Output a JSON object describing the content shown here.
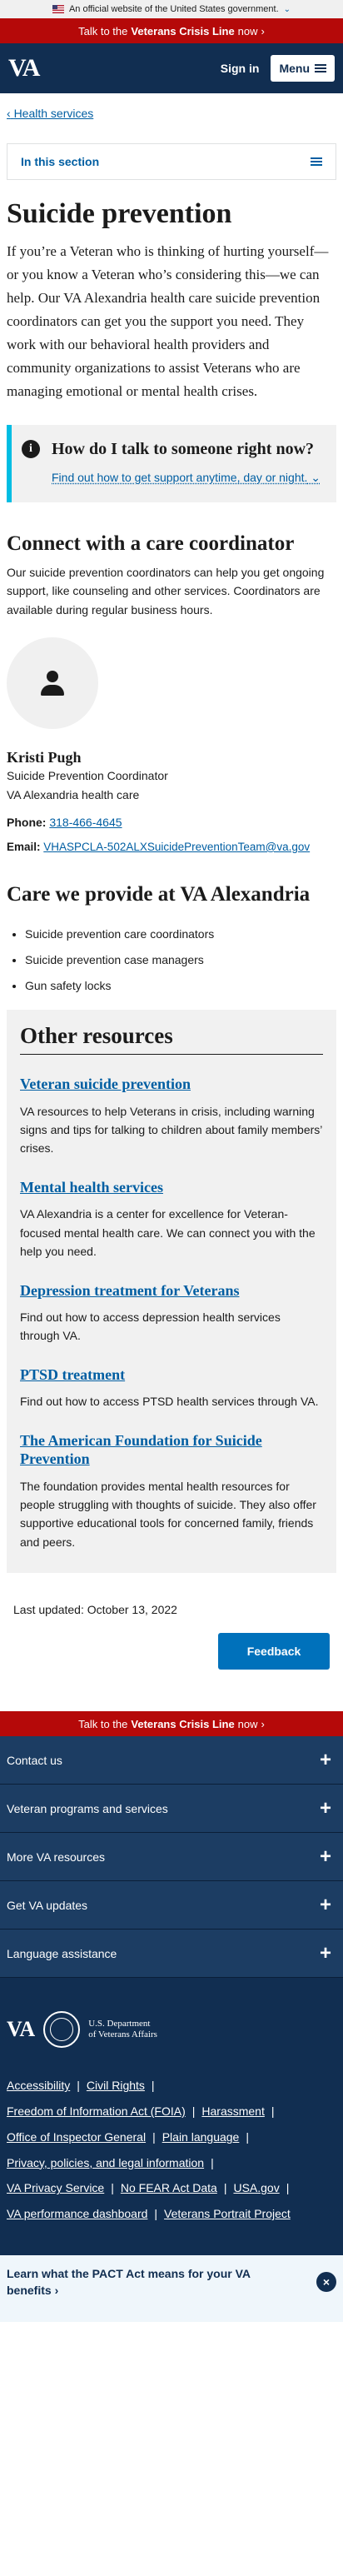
{
  "official_banner": {
    "text": "An official website of the United States government.",
    "chevron": "⌄"
  },
  "crisis_bar": {
    "prefix": "Talk to the",
    "bold": "Veterans Crisis Line",
    "suffix": "now",
    "chevron": "›"
  },
  "header": {
    "logo": "VA",
    "sign_in": "Sign in",
    "menu": "Menu"
  },
  "breadcrumb": {
    "arrow": "‹",
    "label": "Health services"
  },
  "in_section": {
    "label": "In this section"
  },
  "page": {
    "title": "Suicide prevention",
    "intro": "If you’re a Veteran who is thinking of hurting yourself—or you know a Veteran who’s considering this—we can help. Our VA Alexandria health care suicide prevention coordinators can get you the support you need. They work with our behavioral health providers and community organizations to assist Veterans who are managing emotional or mental health crises."
  },
  "alert": {
    "icon": "i",
    "heading": "How do I talk to someone right now?",
    "link": "Find out how to get support anytime, day or night.",
    "chevron": "⌄"
  },
  "coordinator": {
    "heading": "Connect with a care coordinator",
    "body": "Our suicide prevention coordinators can help you get ongoing support, like counseling and other services. Coordinators are available during regular business hours.",
    "name": "Kristi Pugh",
    "role": "Suicide Prevention Coordinator",
    "facility": "VA Alexandria health care",
    "phone_label": "Phone:",
    "phone": "318-466-4645",
    "email_label": "Email:",
    "email": "VHASPCLA-502ALXSuicidePreventionTeam@va.gov"
  },
  "care": {
    "heading": "Care we provide at VA Alexandria",
    "items": [
      "Suicide prevention care coordinators",
      "Suicide prevention case managers",
      "Gun safety locks"
    ]
  },
  "other_resources": {
    "heading": "Other resources",
    "items": [
      {
        "title": "Veteran suicide prevention",
        "desc": "VA resources to help Veterans in crisis, including warning signs and tips for talking to children about family members’ crises."
      },
      {
        "title": "Mental health services",
        "desc": "VA Alexandria is a center for excellence for Veteran-focused mental health care. We can connect you with the help you need."
      },
      {
        "title": "Depression treatment for Veterans",
        "desc": "Find out how to access depression health services through VA."
      },
      {
        "title": "PTSD treatment",
        "desc": "Find out how to access PTSD health services through VA."
      },
      {
        "title": "The American Foundation for Suicide Prevention",
        "desc": "The foundation provides mental health resources for people struggling with thoughts of suicide. They also offer supportive educational tools for concerned family, friends and peers."
      }
    ]
  },
  "last_updated": "Last updated: October 13, 2022",
  "feedback": "Feedback",
  "footer": {
    "accordion": [
      "Contact us",
      "Veteran programs and services",
      "More VA resources",
      "Get VA updates",
      "Language assistance"
    ],
    "plus": "+",
    "logo": "VA",
    "dept_line1": "U.S. Department",
    "dept_line2": "of Veterans Affairs",
    "links": {
      "accessibility": "Accessibility",
      "civil_rights": "Civil Rights",
      "foia": "Freedom of Information Act (FOIA)",
      "harassment": "Harassment",
      "oig": "Office of Inspector General",
      "plain_language": "Plain language",
      "privacy_legal": "Privacy, policies, and legal information",
      "privacy_service": "VA Privacy Service",
      "no_fear": "No FEAR Act Data",
      "usa_gov": "USA.gov",
      "performance": "VA performance dashboard",
      "portrait": "Veterans Portrait Project"
    }
  },
  "pact_bar": {
    "text": "Learn what the PACT Act means for your VA benefits",
    "arrow": "›",
    "close": "×"
  }
}
